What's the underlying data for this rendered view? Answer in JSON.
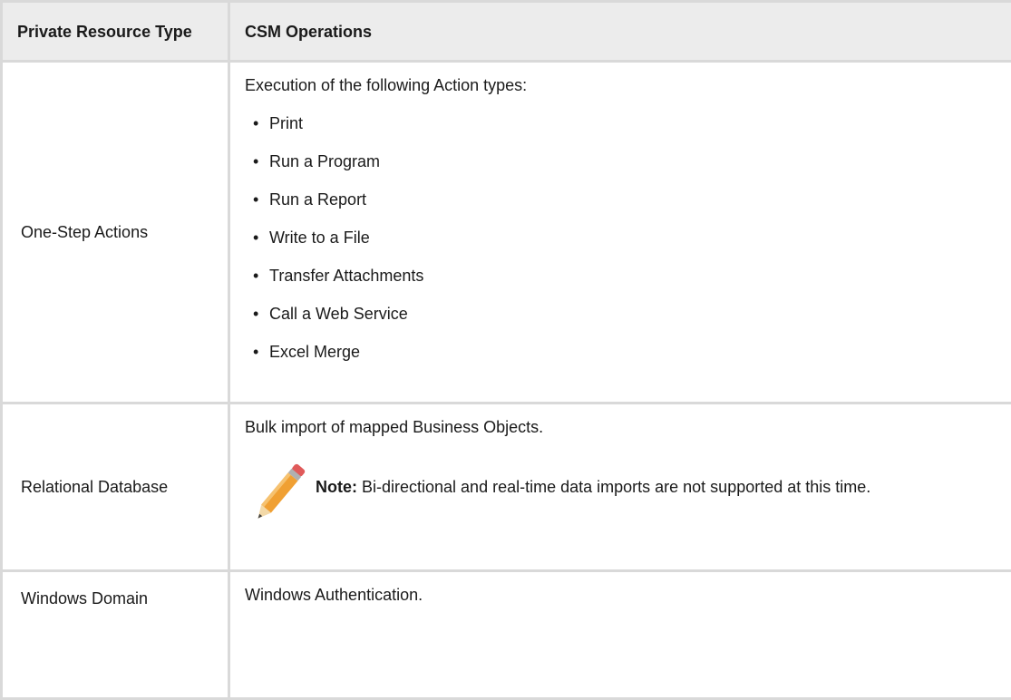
{
  "table": {
    "headers": [
      "Private Resource Type",
      "CSM Operations"
    ],
    "rows": [
      {
        "type": "One-Step Actions",
        "intro": "Execution of the following Action types:",
        "bullets": [
          "Print",
          "Run a Program",
          "Run a Report",
          "Write to a File",
          "Transfer Attachments",
          "Call a Web Service",
          "Excel Merge"
        ]
      },
      {
        "type": "Relational Database",
        "intro": "Bulk import of mapped Business Objects.",
        "note_label": "Note:",
        "note_text": " Bi-directional and real-time data imports are not supported at this time.",
        "note_icon": "pencil-icon"
      },
      {
        "type": "Windows Domain",
        "intro": "Windows Authentication."
      }
    ]
  },
  "bullet_glyph": "•"
}
